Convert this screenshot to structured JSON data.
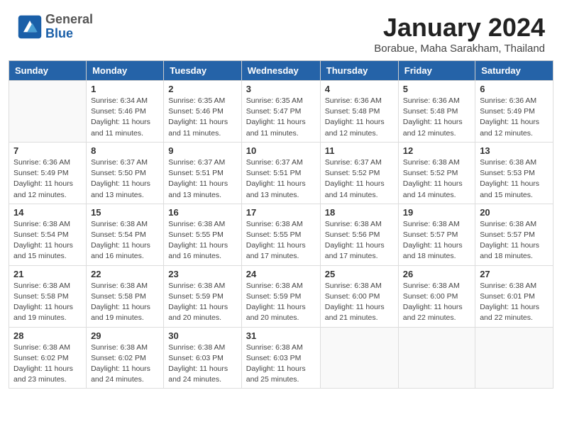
{
  "header": {
    "logo": {
      "general": "General",
      "blue": "Blue"
    },
    "title": "January 2024",
    "location": "Borabue, Maha Sarakham, Thailand"
  },
  "weekdays": [
    "Sunday",
    "Monday",
    "Tuesday",
    "Wednesday",
    "Thursday",
    "Friday",
    "Saturday"
  ],
  "weeks": [
    [
      {
        "day": "",
        "sunrise": "",
        "sunset": "",
        "daylight": ""
      },
      {
        "day": "1",
        "sunrise": "Sunrise: 6:34 AM",
        "sunset": "Sunset: 5:46 PM",
        "daylight": "Daylight: 11 hours and 11 minutes."
      },
      {
        "day": "2",
        "sunrise": "Sunrise: 6:35 AM",
        "sunset": "Sunset: 5:46 PM",
        "daylight": "Daylight: 11 hours and 11 minutes."
      },
      {
        "day": "3",
        "sunrise": "Sunrise: 6:35 AM",
        "sunset": "Sunset: 5:47 PM",
        "daylight": "Daylight: 11 hours and 11 minutes."
      },
      {
        "day": "4",
        "sunrise": "Sunrise: 6:36 AM",
        "sunset": "Sunset: 5:48 PM",
        "daylight": "Daylight: 11 hours and 12 minutes."
      },
      {
        "day": "5",
        "sunrise": "Sunrise: 6:36 AM",
        "sunset": "Sunset: 5:48 PM",
        "daylight": "Daylight: 11 hours and 12 minutes."
      },
      {
        "day": "6",
        "sunrise": "Sunrise: 6:36 AM",
        "sunset": "Sunset: 5:49 PM",
        "daylight": "Daylight: 11 hours and 12 minutes."
      }
    ],
    [
      {
        "day": "7",
        "sunrise": "Sunrise: 6:36 AM",
        "sunset": "Sunset: 5:49 PM",
        "daylight": "Daylight: 11 hours and 12 minutes."
      },
      {
        "day": "8",
        "sunrise": "Sunrise: 6:37 AM",
        "sunset": "Sunset: 5:50 PM",
        "daylight": "Daylight: 11 hours and 13 minutes."
      },
      {
        "day": "9",
        "sunrise": "Sunrise: 6:37 AM",
        "sunset": "Sunset: 5:51 PM",
        "daylight": "Daylight: 11 hours and 13 minutes."
      },
      {
        "day": "10",
        "sunrise": "Sunrise: 6:37 AM",
        "sunset": "Sunset: 5:51 PM",
        "daylight": "Daylight: 11 hours and 13 minutes."
      },
      {
        "day": "11",
        "sunrise": "Sunrise: 6:37 AM",
        "sunset": "Sunset: 5:52 PM",
        "daylight": "Daylight: 11 hours and 14 minutes."
      },
      {
        "day": "12",
        "sunrise": "Sunrise: 6:38 AM",
        "sunset": "Sunset: 5:52 PM",
        "daylight": "Daylight: 11 hours and 14 minutes."
      },
      {
        "day": "13",
        "sunrise": "Sunrise: 6:38 AM",
        "sunset": "Sunset: 5:53 PM",
        "daylight": "Daylight: 11 hours and 15 minutes."
      }
    ],
    [
      {
        "day": "14",
        "sunrise": "Sunrise: 6:38 AM",
        "sunset": "Sunset: 5:54 PM",
        "daylight": "Daylight: 11 hours and 15 minutes."
      },
      {
        "day": "15",
        "sunrise": "Sunrise: 6:38 AM",
        "sunset": "Sunset: 5:54 PM",
        "daylight": "Daylight: 11 hours and 16 minutes."
      },
      {
        "day": "16",
        "sunrise": "Sunrise: 6:38 AM",
        "sunset": "Sunset: 5:55 PM",
        "daylight": "Daylight: 11 hours and 16 minutes."
      },
      {
        "day": "17",
        "sunrise": "Sunrise: 6:38 AM",
        "sunset": "Sunset: 5:55 PM",
        "daylight": "Daylight: 11 hours and 17 minutes."
      },
      {
        "day": "18",
        "sunrise": "Sunrise: 6:38 AM",
        "sunset": "Sunset: 5:56 PM",
        "daylight": "Daylight: 11 hours and 17 minutes."
      },
      {
        "day": "19",
        "sunrise": "Sunrise: 6:38 AM",
        "sunset": "Sunset: 5:57 PM",
        "daylight": "Daylight: 11 hours and 18 minutes."
      },
      {
        "day": "20",
        "sunrise": "Sunrise: 6:38 AM",
        "sunset": "Sunset: 5:57 PM",
        "daylight": "Daylight: 11 hours and 18 minutes."
      }
    ],
    [
      {
        "day": "21",
        "sunrise": "Sunrise: 6:38 AM",
        "sunset": "Sunset: 5:58 PM",
        "daylight": "Daylight: 11 hours and 19 minutes."
      },
      {
        "day": "22",
        "sunrise": "Sunrise: 6:38 AM",
        "sunset": "Sunset: 5:58 PM",
        "daylight": "Daylight: 11 hours and 19 minutes."
      },
      {
        "day": "23",
        "sunrise": "Sunrise: 6:38 AM",
        "sunset": "Sunset: 5:59 PM",
        "daylight": "Daylight: 11 hours and 20 minutes."
      },
      {
        "day": "24",
        "sunrise": "Sunrise: 6:38 AM",
        "sunset": "Sunset: 5:59 PM",
        "daylight": "Daylight: 11 hours and 20 minutes."
      },
      {
        "day": "25",
        "sunrise": "Sunrise: 6:38 AM",
        "sunset": "Sunset: 6:00 PM",
        "daylight": "Daylight: 11 hours and 21 minutes."
      },
      {
        "day": "26",
        "sunrise": "Sunrise: 6:38 AM",
        "sunset": "Sunset: 6:00 PM",
        "daylight": "Daylight: 11 hours and 22 minutes."
      },
      {
        "day": "27",
        "sunrise": "Sunrise: 6:38 AM",
        "sunset": "Sunset: 6:01 PM",
        "daylight": "Daylight: 11 hours and 22 minutes."
      }
    ],
    [
      {
        "day": "28",
        "sunrise": "Sunrise: 6:38 AM",
        "sunset": "Sunset: 6:02 PM",
        "daylight": "Daylight: 11 hours and 23 minutes."
      },
      {
        "day": "29",
        "sunrise": "Sunrise: 6:38 AM",
        "sunset": "Sunset: 6:02 PM",
        "daylight": "Daylight: 11 hours and 24 minutes."
      },
      {
        "day": "30",
        "sunrise": "Sunrise: 6:38 AM",
        "sunset": "Sunset: 6:03 PM",
        "daylight": "Daylight: 11 hours and 24 minutes."
      },
      {
        "day": "31",
        "sunrise": "Sunrise: 6:38 AM",
        "sunset": "Sunset: 6:03 PM",
        "daylight": "Daylight: 11 hours and 25 minutes."
      },
      {
        "day": "",
        "sunrise": "",
        "sunset": "",
        "daylight": ""
      },
      {
        "day": "",
        "sunrise": "",
        "sunset": "",
        "daylight": ""
      },
      {
        "day": "",
        "sunrise": "",
        "sunset": "",
        "daylight": ""
      }
    ]
  ]
}
